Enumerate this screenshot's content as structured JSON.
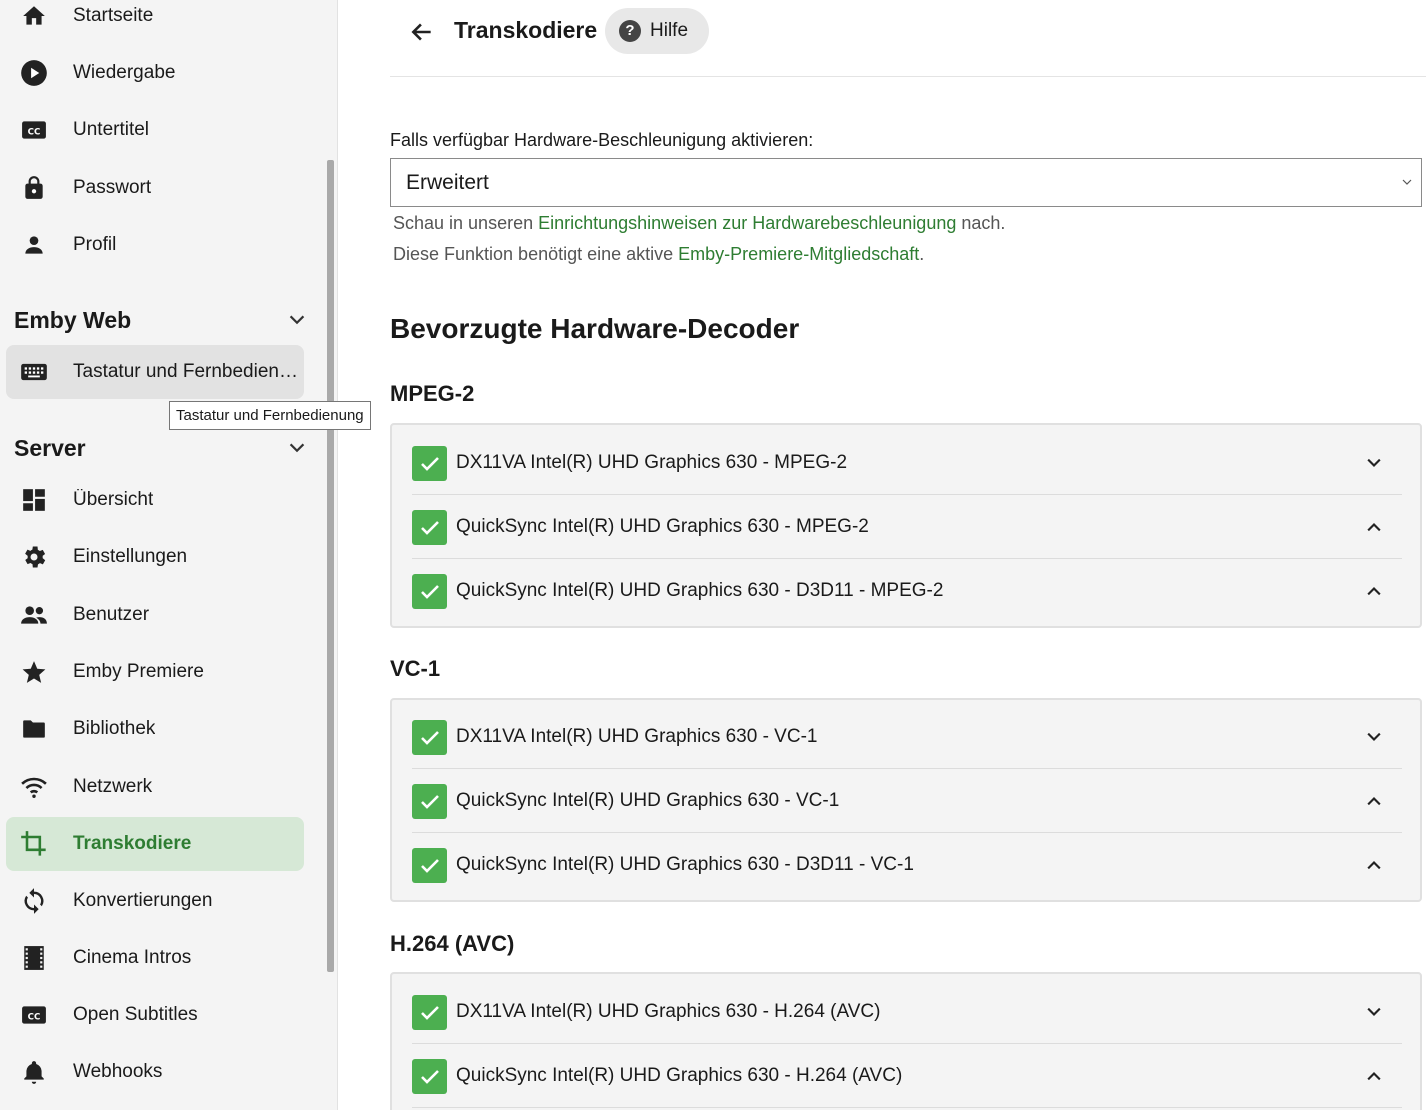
{
  "sidebar": {
    "top_items": [
      {
        "label": "Startseite",
        "icon": "home-icon"
      },
      {
        "label": "Wiedergabe",
        "icon": "play-circle-icon"
      },
      {
        "label": "Untertitel",
        "icon": "closed-caption-icon"
      },
      {
        "label": "Passwort",
        "icon": "lock-icon"
      },
      {
        "label": "Profil",
        "icon": "person-icon"
      }
    ],
    "section_web": {
      "title": "Emby Web",
      "items": [
        {
          "label": "Tastatur und Fernbedienung",
          "icon": "keyboard-icon"
        }
      ]
    },
    "tooltip": "Tastatur und Fernbedienung",
    "section_server": {
      "title": "Server",
      "items": [
        {
          "label": "Übersicht",
          "icon": "dashboard-icon"
        },
        {
          "label": "Einstellungen",
          "icon": "gear-icon"
        },
        {
          "label": "Benutzer",
          "icon": "people-icon"
        },
        {
          "label": "Emby Premiere",
          "icon": "star-icon"
        },
        {
          "label": "Bibliothek",
          "icon": "folder-icon"
        },
        {
          "label": "Netzwerk",
          "icon": "wifi-icon"
        },
        {
          "label": "Transkodiere",
          "icon": "crop-icon",
          "active": true
        },
        {
          "label": "Konvertierungen",
          "icon": "sync-icon"
        },
        {
          "label": "Cinema Intros",
          "icon": "film-icon"
        },
        {
          "label": "Open Subtitles",
          "icon": "closed-caption-icon"
        },
        {
          "label": "Webhooks",
          "icon": "bell-icon"
        }
      ]
    }
  },
  "header": {
    "title": "Transkodiere",
    "help_label": "Hilfe"
  },
  "hw_accel": {
    "label": "Falls verfügbar Hardware-Beschleunigung aktivieren:",
    "value": "Erweitert",
    "hint1_pre": "Schau in unseren ",
    "hint1_link": "Einrichtungshinweisen zur Hardwarebeschleunigung",
    "hint1_post": " nach.",
    "hint2_pre": "Diese Funktion benötigt eine aktive ",
    "hint2_link": "Emby-Premiere-Mitgliedschaft",
    "hint2_post": "."
  },
  "decoders": {
    "heading": "Bevorzugte Hardware-Decoder",
    "groups": [
      {
        "title": "MPEG-2",
        "items": [
          {
            "label": "DX11VA Intel(R) UHD Graphics 630 - MPEG-2",
            "checked": true,
            "chevron": "down"
          },
          {
            "label": "QuickSync Intel(R) UHD Graphics 630 - MPEG-2",
            "checked": true,
            "chevron": "up"
          },
          {
            "label": "QuickSync Intel(R) UHD Graphics 630 - D3D11 - MPEG-2",
            "checked": true,
            "chevron": "up"
          }
        ]
      },
      {
        "title": "VC-1",
        "items": [
          {
            "label": "DX11VA Intel(R) UHD Graphics 630 - VC-1",
            "checked": true,
            "chevron": "down"
          },
          {
            "label": "QuickSync Intel(R) UHD Graphics 630 - VC-1",
            "checked": true,
            "chevron": "up"
          },
          {
            "label": "QuickSync Intel(R) UHD Graphics 630 - D3D11 - VC-1",
            "checked": true,
            "chevron": "up"
          }
        ]
      },
      {
        "title": "H.264 (AVC)",
        "items": [
          {
            "label": "DX11VA Intel(R) UHD Graphics 630 - H.264 (AVC)",
            "checked": true,
            "chevron": "down"
          },
          {
            "label": "QuickSync Intel(R) UHD Graphics 630 - H.264 (AVC)",
            "checked": true,
            "chevron": "up"
          }
        ]
      }
    ]
  },
  "colors": {
    "accent": "#2e7d32",
    "checkbox": "#4caf50",
    "active_bg": "#d6e8d6"
  }
}
